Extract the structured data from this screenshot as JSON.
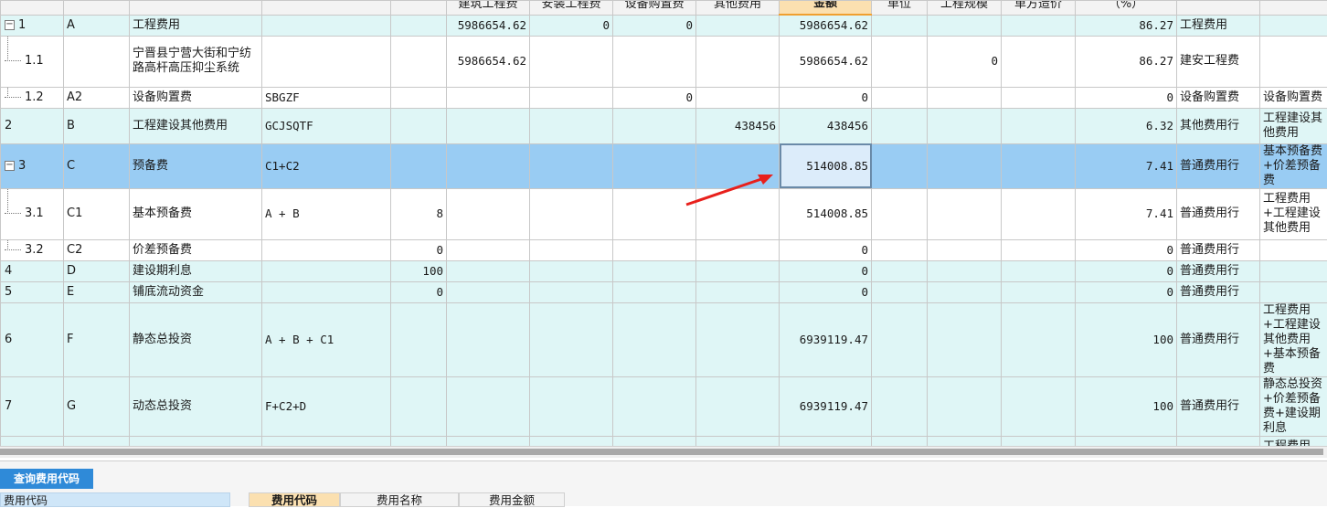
{
  "headers": [
    "",
    "",
    "",
    "",
    "",
    "建筑工程费",
    "安装工程费",
    "设备购置费",
    "其他费用",
    "金额",
    "单位",
    "工程规模",
    "单方造价",
    "（%）",
    "",
    ""
  ],
  "rows": [
    {
      "no": "1",
      "code": "A",
      "name": "工程费用",
      "formula": "",
      "rate": "",
      "jz": "5986654.62",
      "az": "0",
      "sb": "0",
      "qt": "",
      "amt": "5986654.62",
      "unit": "",
      "scale": "",
      "unitcost": "",
      "pct": "86.27",
      "type": "工程费用",
      "remark": ""
    },
    {
      "no": "1.1",
      "code": "",
      "name": "宁晋县宁营大街和宁纺路高杆高压抑尘系统",
      "formula": "",
      "rate": "",
      "jz": "5986654.62",
      "az": "",
      "sb": "",
      "qt": "",
      "amt": "5986654.62",
      "unit": "",
      "scale": "0",
      "unitcost": "",
      "pct": "86.27",
      "type": "建安工程费",
      "remark": ""
    },
    {
      "no": "1.2",
      "code": "A2",
      "name": "设备购置费",
      "formula": "SBGZF",
      "rate": "",
      "jz": "",
      "az": "",
      "sb": "0",
      "qt": "",
      "amt": "0",
      "unit": "",
      "scale": "",
      "unitcost": "",
      "pct": "0",
      "type": "设备购置费",
      "remark": "设备购置费"
    },
    {
      "no": "2",
      "code": "B",
      "name": "工程建设其他费用",
      "formula": "GCJSQTF",
      "rate": "",
      "jz": "",
      "az": "",
      "sb": "",
      "qt": "438456",
      "amt": "438456",
      "unit": "",
      "scale": "",
      "unitcost": "",
      "pct": "6.32",
      "type": "其他费用行",
      "remark": "工程建设其他费用"
    },
    {
      "no": "3",
      "code": "C",
      "name": "预备费",
      "formula": "C1+C2",
      "rate": "",
      "jz": "",
      "az": "",
      "sb": "",
      "qt": "",
      "amt": "514008.85",
      "unit": "",
      "scale": "",
      "unitcost": "",
      "pct": "7.41",
      "type": "普通费用行",
      "remark": "基本预备费+价差预备费"
    },
    {
      "no": "3.1",
      "code": "C1",
      "name": "基本预备费",
      "formula": "A + B",
      "rate": "8",
      "jz": "",
      "az": "",
      "sb": "",
      "qt": "",
      "amt": "514008.85",
      "unit": "",
      "scale": "",
      "unitcost": "",
      "pct": "7.41",
      "type": "普通费用行",
      "remark": "工程费用+工程建设其他费用"
    },
    {
      "no": "3.2",
      "code": "C2",
      "name": "价差预备费",
      "formula": "",
      "rate": "0",
      "jz": "",
      "az": "",
      "sb": "",
      "qt": "",
      "amt": "0",
      "unit": "",
      "scale": "",
      "unitcost": "",
      "pct": "0",
      "type": "普通费用行",
      "remark": ""
    },
    {
      "no": "4",
      "code": "D",
      "name": "建设期利息",
      "formula": "",
      "rate": "100",
      "jz": "",
      "az": "",
      "sb": "",
      "qt": "",
      "amt": "0",
      "unit": "",
      "scale": "",
      "unitcost": "",
      "pct": "0",
      "type": "普通费用行",
      "remark": ""
    },
    {
      "no": "5",
      "code": "E",
      "name": "铺底流动资金",
      "formula": "",
      "rate": "0",
      "jz": "",
      "az": "",
      "sb": "",
      "qt": "",
      "amt": "0",
      "unit": "",
      "scale": "",
      "unitcost": "",
      "pct": "0",
      "type": "普通费用行",
      "remark": ""
    },
    {
      "no": "6",
      "code": "F",
      "name": "静态总投资",
      "formula": "A + B + C1",
      "rate": "",
      "jz": "",
      "az": "",
      "sb": "",
      "qt": "",
      "amt": "6939119.47",
      "unit": "",
      "scale": "",
      "unitcost": "",
      "pct": "100",
      "type": "普通费用行",
      "remark": "工程费用+工程建设其他费用+基本预备费"
    },
    {
      "no": "7",
      "code": "G",
      "name": "动态总投资",
      "formula": "F+C2+D",
      "rate": "",
      "jz": "",
      "az": "",
      "sb": "",
      "qt": "",
      "amt": "6939119.47",
      "unit": "",
      "scale": "",
      "unitcost": "",
      "pct": "100",
      "type": "普通费用行",
      "remark": "静态总投资+价差预备费+建设期利息"
    },
    {
      "no": "",
      "code": "",
      "name": "",
      "formula": "",
      "rate": "",
      "jz": "",
      "az": "",
      "sb": "",
      "qt": "",
      "amt": "",
      "unit": "",
      "scale": "",
      "unitcost": "",
      "pct": "",
      "type": "",
      "remark": "工程费用+工程建设其他"
    }
  ],
  "bottom": {
    "tab_label": "查询费用代码",
    "left_header": "费用代码",
    "col_code": "费用代码",
    "col_name": "费用名称",
    "col_amount": "费用金额"
  }
}
